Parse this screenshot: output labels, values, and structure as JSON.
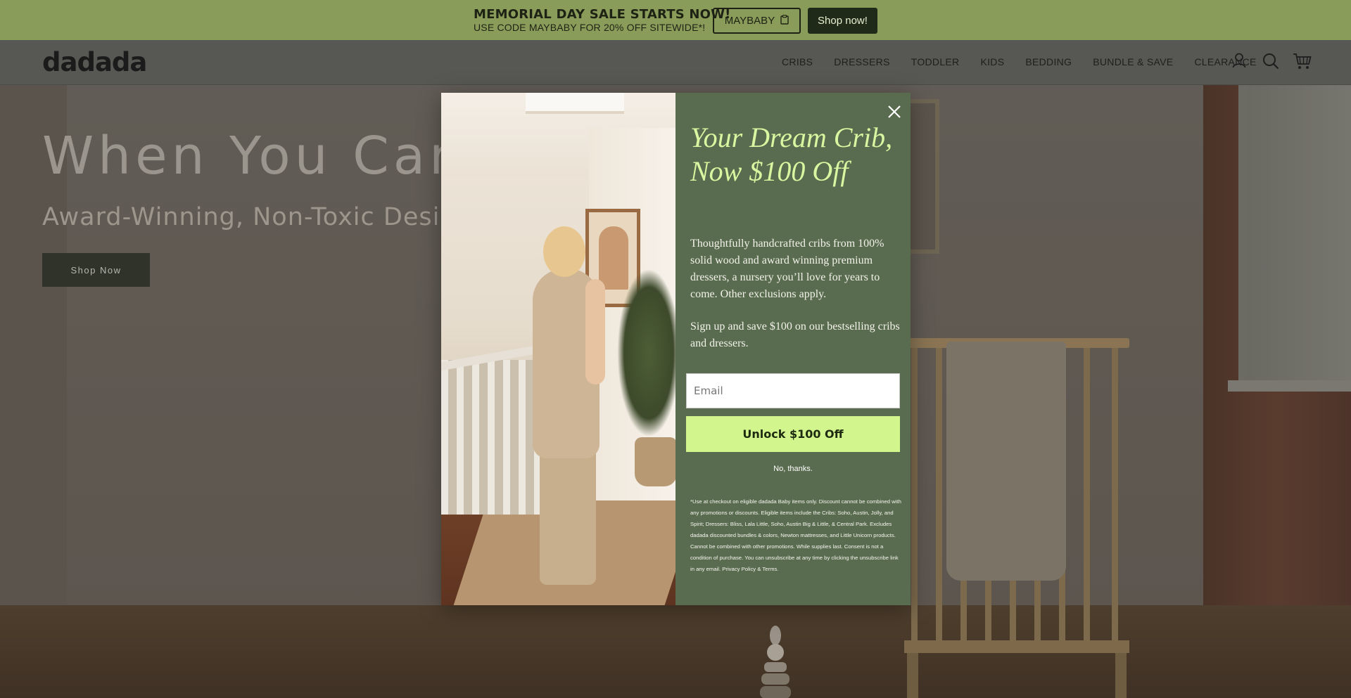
{
  "announcement": {
    "headline": "MEMORIAL DAY SALE STARTS NOW!",
    "subline": "USE CODE MAYBABY FOR 20% OFF SITEWIDE*!",
    "code_label": "MAYBABY",
    "shop_label": "Shop now!"
  },
  "header": {
    "logo": "dadada",
    "nav": [
      "CRIBS",
      "DRESSERS",
      "TODDLER",
      "KIDS",
      "BEDDING",
      "BUNDLE & SAVE",
      "CLEARANCE"
    ]
  },
  "hero": {
    "title": "When You Care",
    "subtitle": "Award-Winning, Non-Toxic Design f",
    "button_label": "Shop Now"
  },
  "modal": {
    "headline": "Your Dream Crib, Now $100 Off",
    "body": "Thoughtfully handcrafted cribs from 100% solid wood and award winning premium dressers, a nursery you’ll love for years to come. Other exclusions apply.",
    "body2": "Sign up and save $100 on our bestselling cribs and dressers.",
    "email_placeholder": "Email",
    "submit_label": "Unlock $100 Off",
    "decline_label": "No, thanks.",
    "fine_print": "*Use at checkout on eligible dadada Baby items only. Discount cannot be combined with any promotions or discounts. Eligible items include the Cribs: Soho, Austin, Jolly, and Spirit; Dressers: Bliss, Lala Little, Soho, Austin Big & Little, & Central Park. Excludes dadada discounted bundles & colors, Newton mattresses, and Little Unicorn products. Cannot be combined with other promotions. While supplies last. Consent is not a condition of purchase. You can unsubscribe at any time by clicking the unsubscribe link in any email. Privacy Policy & Terms."
  },
  "colors": {
    "announcement_bg": "#8a9c5a",
    "modal_panel": "#5a6c4f",
    "headline_accent": "#d8f7a0",
    "cta": "#d2f58e"
  },
  "icons": [
    "clipboard-icon",
    "account-icon",
    "search-icon",
    "cart-icon",
    "close-icon"
  ]
}
